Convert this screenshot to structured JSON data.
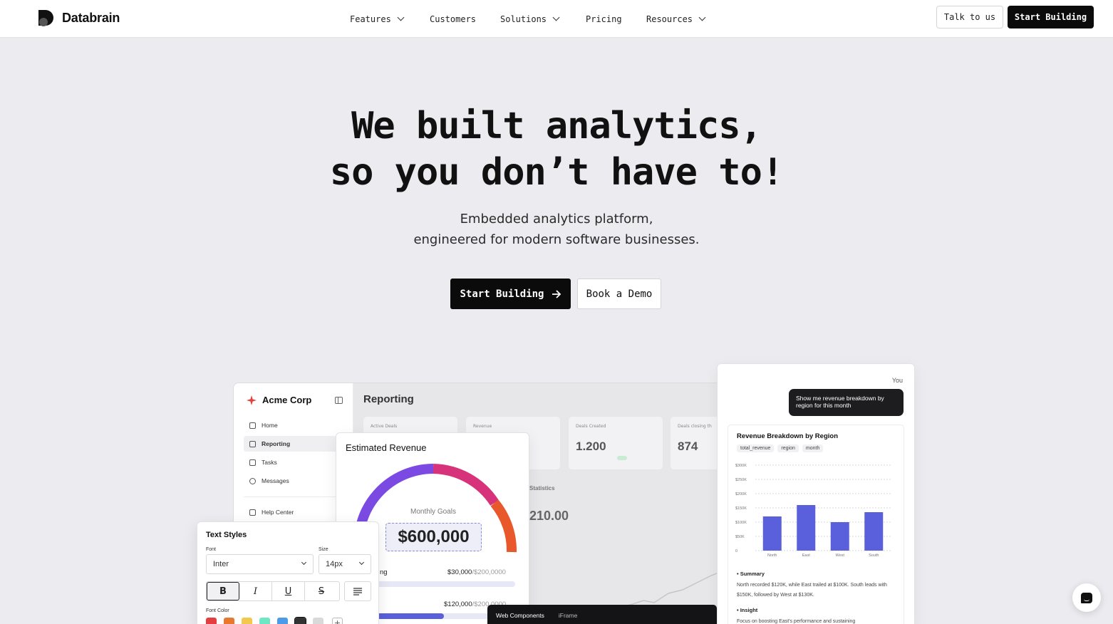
{
  "nav": {
    "brand": "Databrain",
    "items": [
      {
        "label": "Features",
        "dropdown": true
      },
      {
        "label": "Customers",
        "dropdown": false
      },
      {
        "label": "Solutions",
        "dropdown": true
      },
      {
        "label": "Pricing",
        "dropdown": false
      },
      {
        "label": "Resources",
        "dropdown": true
      }
    ],
    "talk_label": "Talk to us",
    "start_label": "Start Building"
  },
  "hero": {
    "title_line1": "We built analytics,",
    "title_line2": "so you don’t have to!",
    "subtitle_line1": "Embedded analytics platform,",
    "subtitle_line2": "engineered for modern software businesses.",
    "cta_primary": "Start Building",
    "cta_secondary": "Book a Demo"
  },
  "dashboard": {
    "company": "Acme Corp",
    "sidebar": [
      {
        "label": "Home",
        "icon": "home-icon"
      },
      {
        "label": "Reporting",
        "icon": "report-icon",
        "active": true
      },
      {
        "label": "Tasks",
        "icon": "document-icon"
      },
      {
        "label": "Messages",
        "icon": "message-icon"
      },
      {
        "label": "Help Center",
        "icon": "help-icon"
      }
    ],
    "title": "Reporting",
    "stats": [
      {
        "label": "Active Deals",
        "value": ""
      },
      {
        "label": "Revenue",
        "value": ""
      },
      {
        "label": "Deals Created",
        "value": "1.200"
      },
      {
        "label": "Deals closing th",
        "value": "874"
      }
    ],
    "statistics_label": "Statistics",
    "statistics_value": "210.00"
  },
  "estimated_revenue": {
    "title": "Estimated Revenue",
    "goal_label": "Monthly Goals",
    "goal_value": "$600,000",
    "row1_label": "ng",
    "row1_value": "$30,000",
    "row1_total": "/$200,0000",
    "row1_progress": 0.04,
    "row2_value": "$120,000",
    "row2_total": "/$200,0000",
    "row2_progress": 0.6,
    "gauge_colors": [
      "#7b4ae3",
      "#d6337a",
      "#e8582b"
    ]
  },
  "text_styles": {
    "title": "Text Styles",
    "font_label": "Font",
    "font_value": "Inter",
    "size_label": "Size",
    "size_value": "14px",
    "format_buttons": [
      "B",
      "I",
      "U",
      "S"
    ],
    "font_color_label": "Font Color",
    "swatches": [
      "#e53e3e",
      "#e8782f",
      "#f2c94c",
      "#6ee7c5",
      "#4a9be8",
      "#333333",
      "#d9d9d9"
    ]
  },
  "chat": {
    "you_label": "You",
    "message": "Show me revenue breakdown by region for this month",
    "chart_title": "Revenue Breakdown by Region",
    "chips": [
      "total_revenue",
      "region",
      "month"
    ],
    "summary_head": "Summary",
    "summary_text": "North recorded $120K, while East trailed at $100K. South leads with $150K, followed by West at $130K.",
    "insight_head": "Insight",
    "insight_text": "Focus on boosting East's performance and sustaining"
  },
  "chart_data": {
    "type": "bar",
    "title": "Revenue Breakdown by Region",
    "categories": [
      "North",
      "East",
      "West",
      "South"
    ],
    "values": [
      120000,
      160000,
      100000,
      135000
    ],
    "ylim": [
      0,
      300000
    ],
    "yticks": [
      "$300K",
      "$250K",
      "$200K",
      "$150K",
      "$100K",
      "$50K",
      "0"
    ],
    "grid": true,
    "color": "#5a5fdc"
  },
  "web_components": {
    "tab1": "Web Components",
    "tab2": "iFrame"
  }
}
